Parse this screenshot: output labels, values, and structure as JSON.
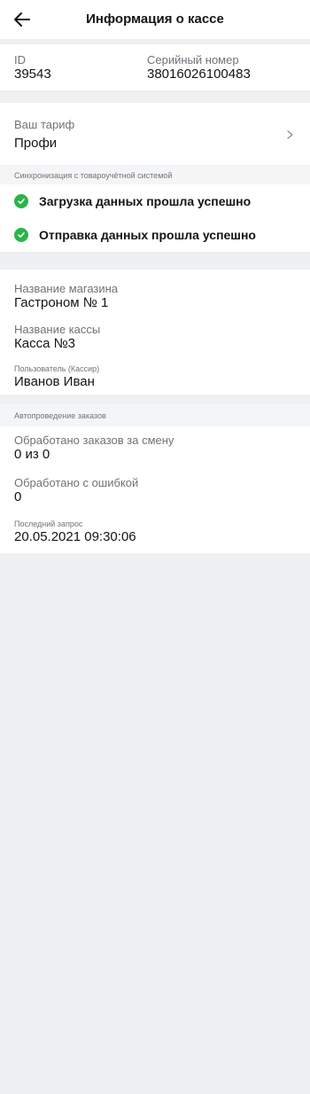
{
  "header": {
    "title": "Информация о кассе",
    "back_icon": "arrow-left-icon"
  },
  "ids": {
    "id_label": "ID",
    "id_value": "39543",
    "serial_label": "Серийный номер",
    "serial_value": "38016026100483"
  },
  "tariff": {
    "label": "Ваш тариф",
    "value": "Профи",
    "chevron_icon": "chevron-right-icon"
  },
  "sync": {
    "section_label": "Синхронизация с товароучётной системой",
    "items": [
      {
        "text": "Загрузка данных прошла успешно",
        "icon": "check-circle-icon"
      },
      {
        "text": "Отправка данных прошла успешно",
        "icon": "check-circle-icon"
      }
    ],
    "success_color": "#2cb34a"
  },
  "store": {
    "store_name_label": "Название магазина",
    "store_name_value": "Гастроном № 1",
    "register_name_label": "Название кассы",
    "register_name_value": "Касса №3",
    "user_label": "Пользователь (Кассир)",
    "user_value": "Иванов Иван"
  },
  "orders": {
    "section_label": "Автопроведение заказов",
    "processed_label": "Обработано заказов за смену",
    "processed_value": "0 из 0",
    "errors_label": "Обработано с ошибкой",
    "errors_value": "0",
    "last_request_label": "Последний запрос",
    "last_request_value": "20.05.2021 09:30:06"
  }
}
